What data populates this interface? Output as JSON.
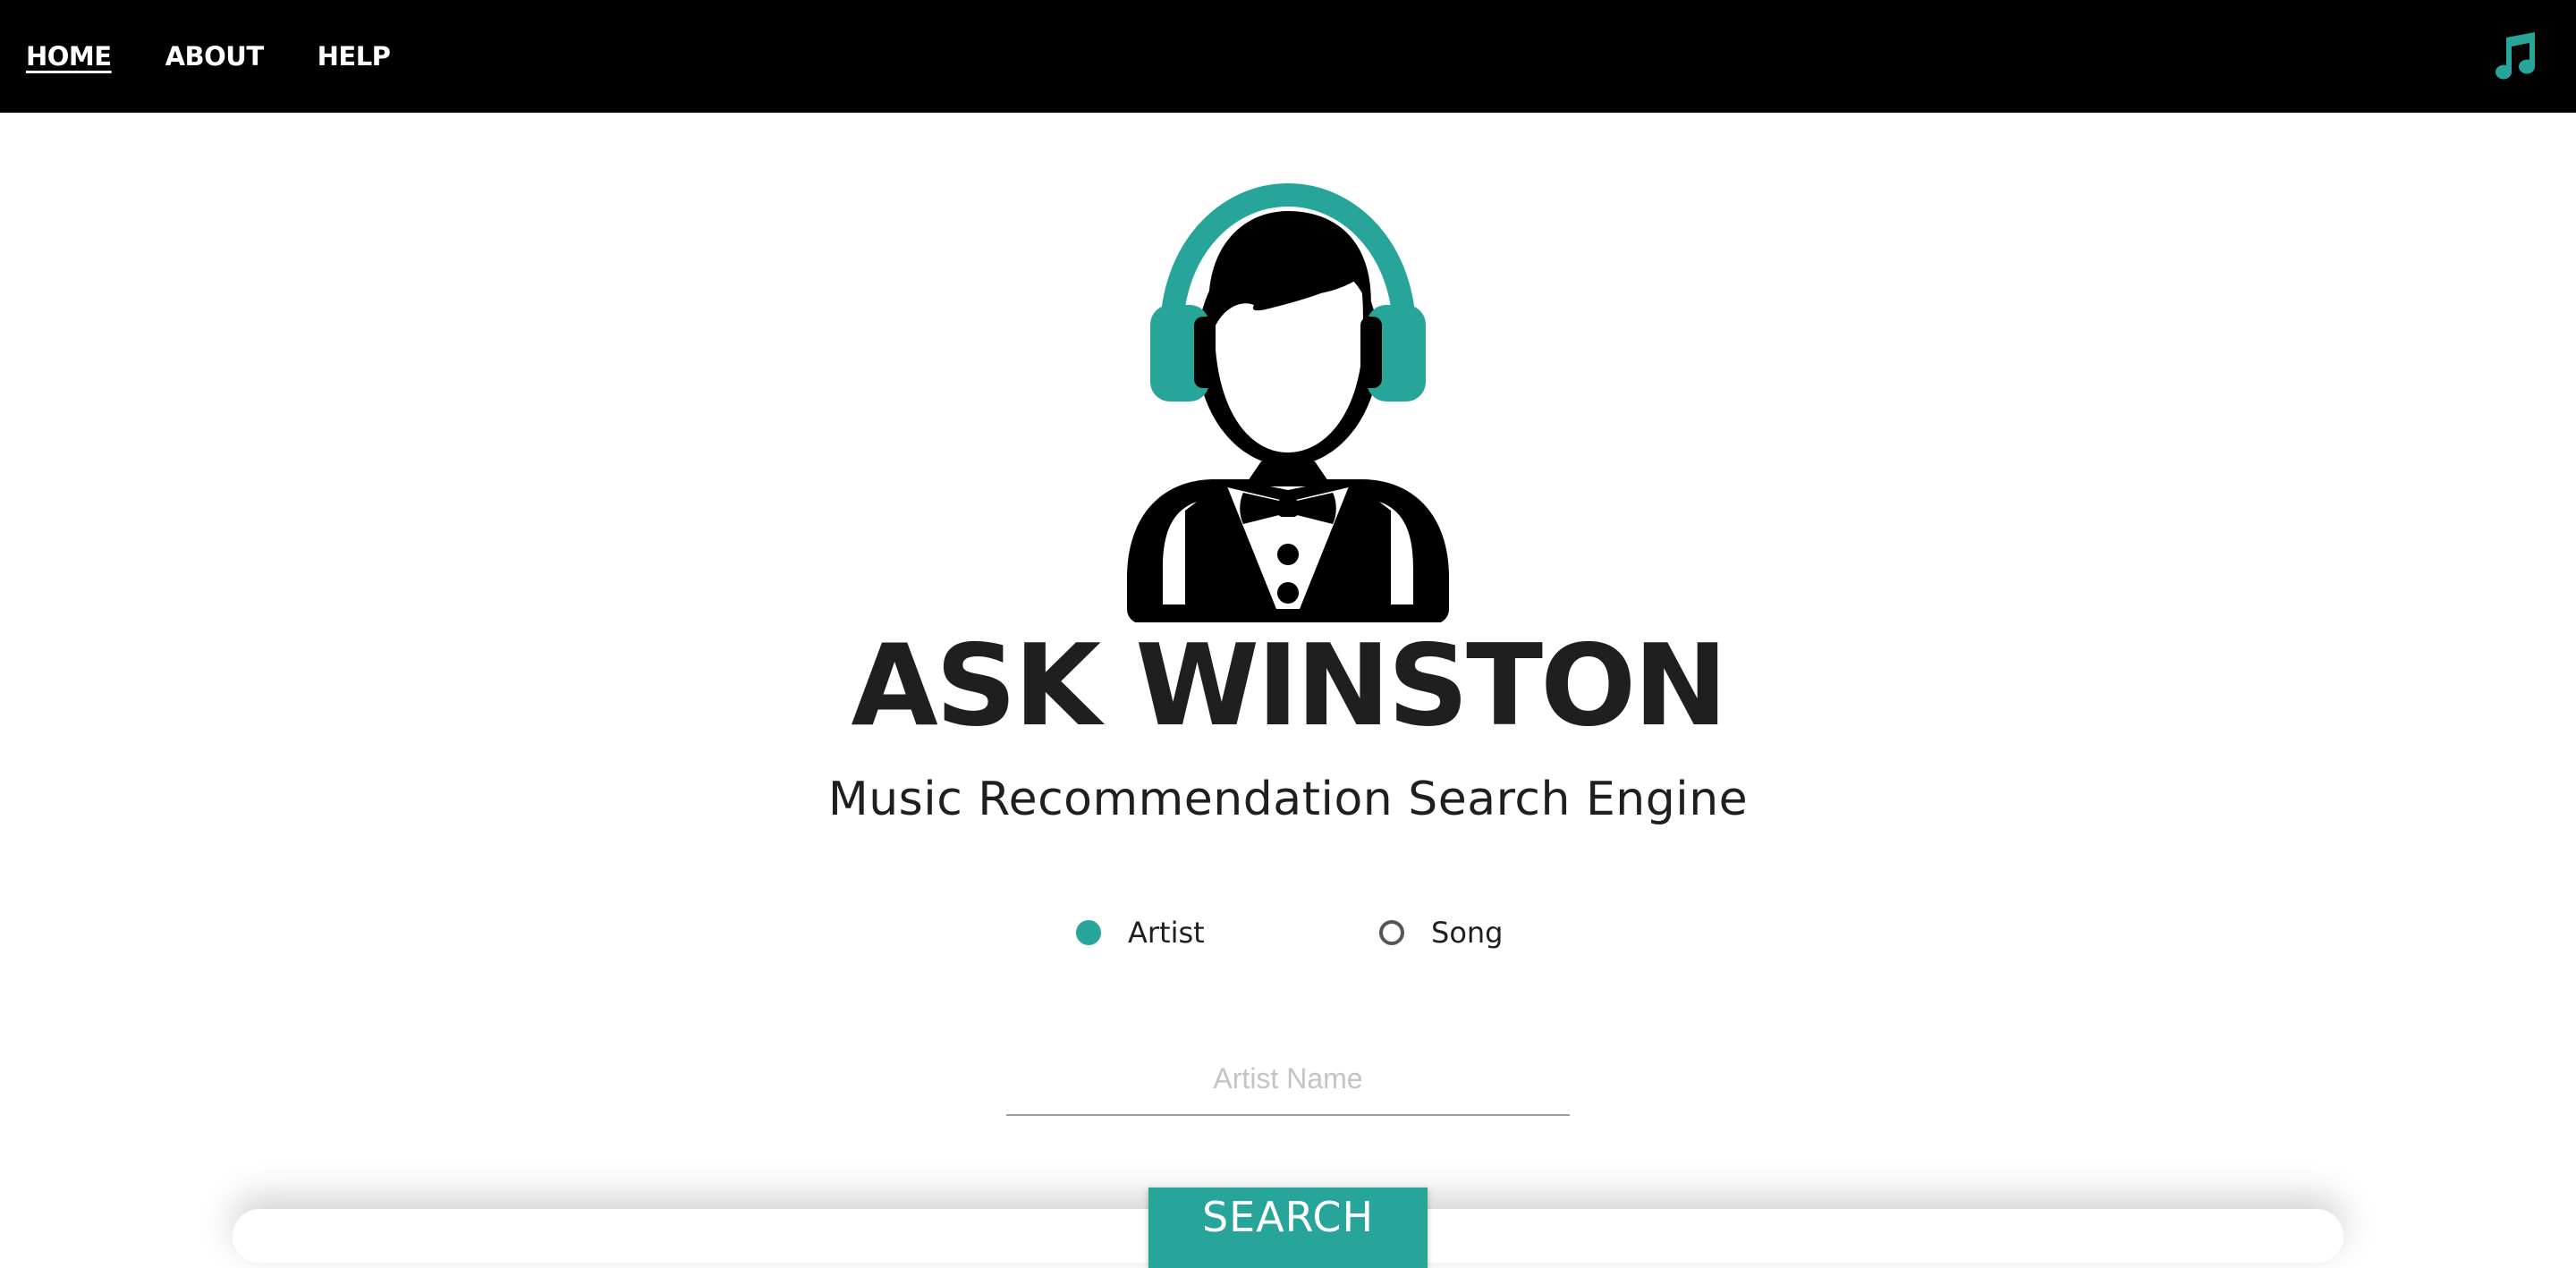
{
  "nav": {
    "home_label": "HOME",
    "about_label": "ABOUT",
    "help_label": "HELP",
    "right_icon": "music-note-icon"
  },
  "logo": {
    "icon": "butler-with-headphones-logo"
  },
  "hero": {
    "title": "ASK WINSTON",
    "subtitle": "Music Recommendation Search Engine"
  },
  "search_type": {
    "options": [
      {
        "label": "Artist",
        "checked": true
      },
      {
        "label": "Song",
        "checked": false
      }
    ]
  },
  "search": {
    "placeholder": "Artist Name",
    "value": "",
    "button_label": "SEARCH"
  },
  "colors": {
    "accent": "#27a59a",
    "navbar_bg": "#000000",
    "text": "#1f1f1f"
  }
}
